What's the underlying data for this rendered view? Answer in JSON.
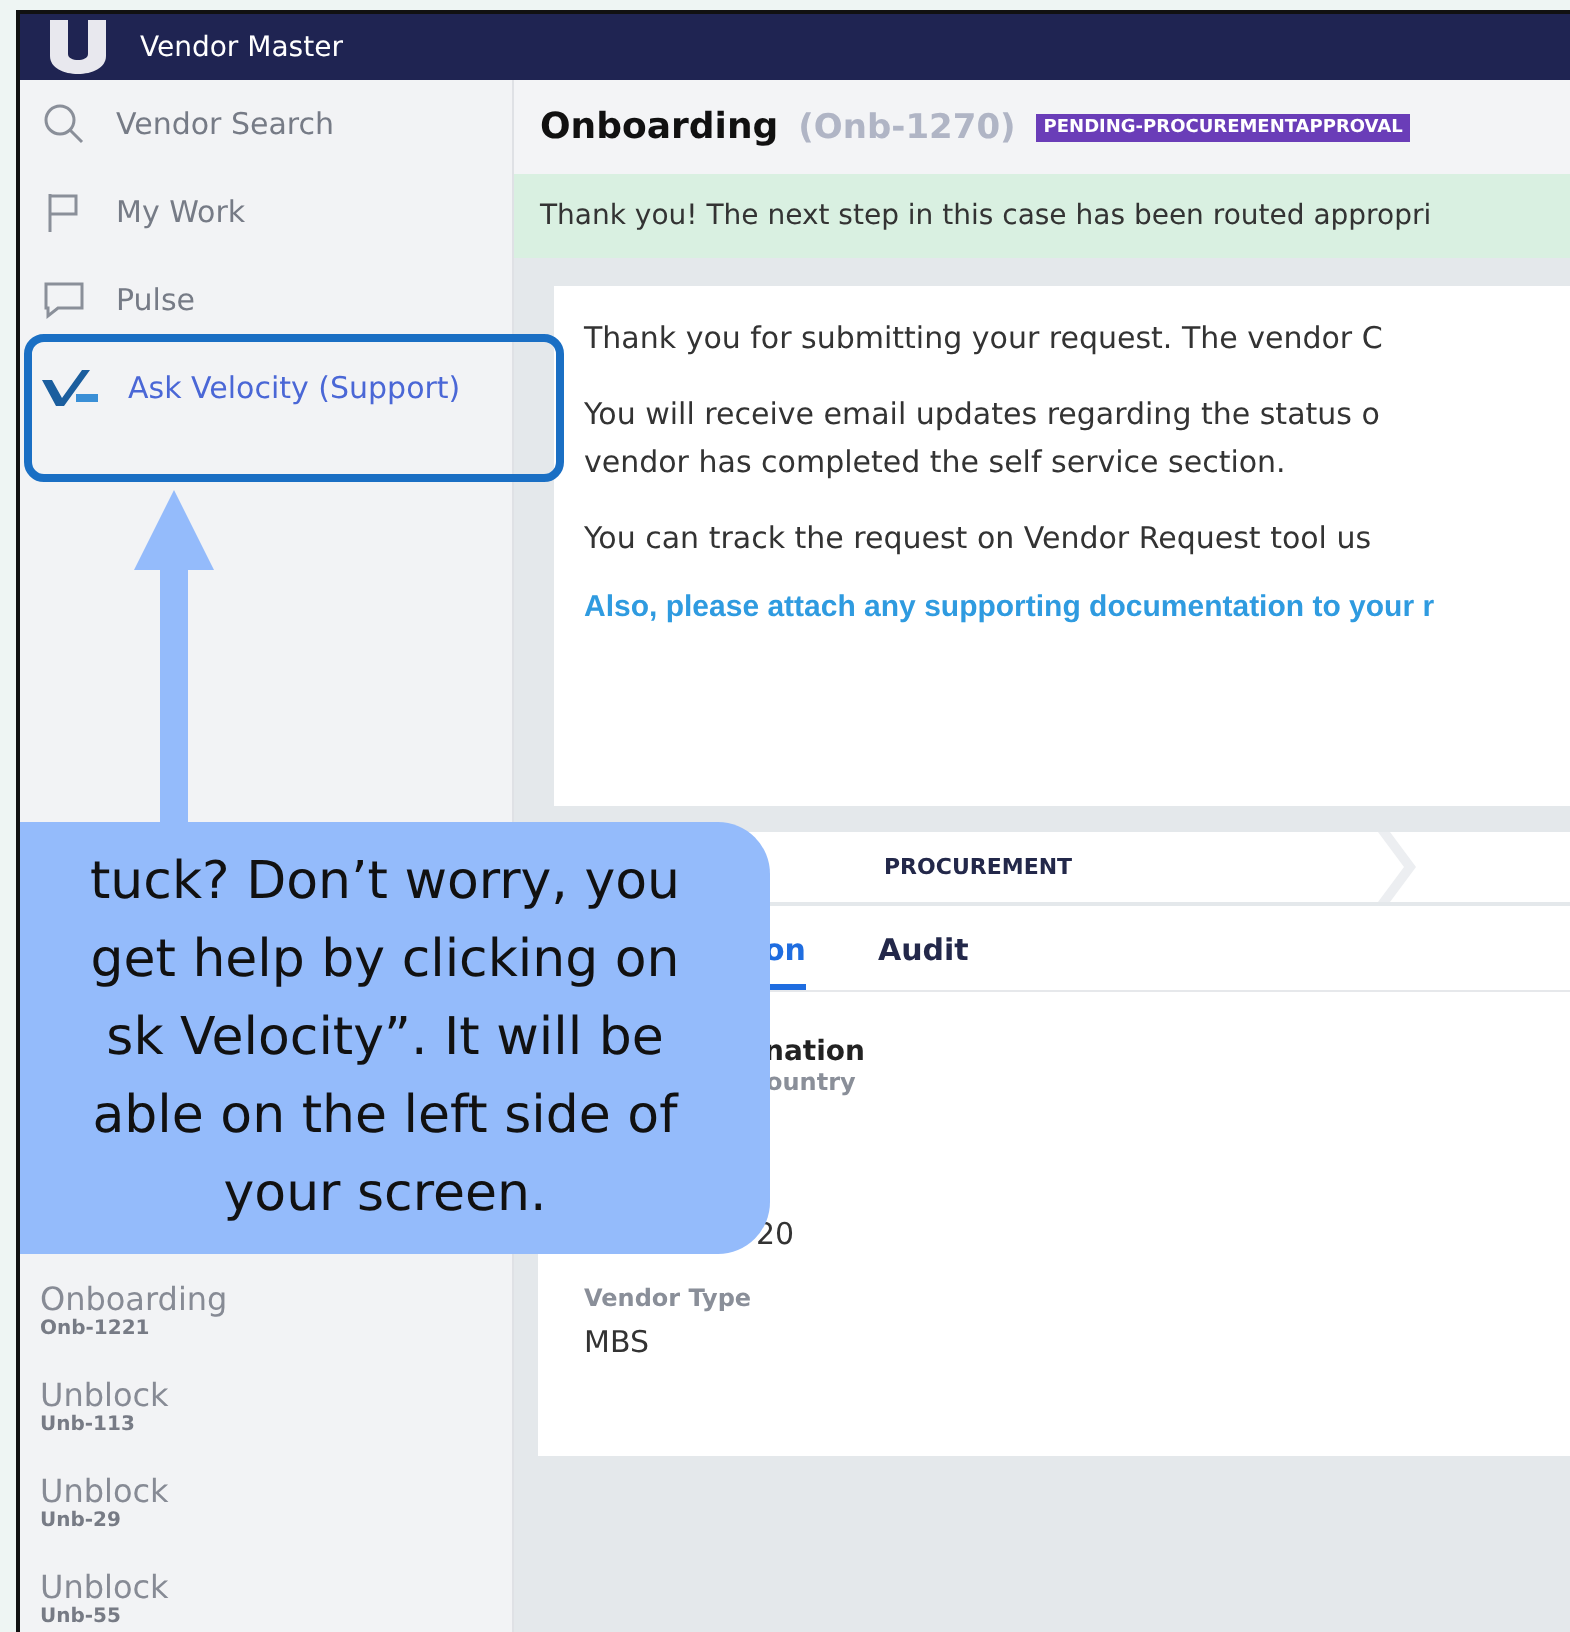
{
  "header": {
    "title": "Vendor Master"
  },
  "nav": [
    {
      "label": "Vendor Search",
      "kind": "search"
    },
    {
      "label": "My Work",
      "kind": "flag"
    },
    {
      "label": "Pulse",
      "kind": "chat"
    },
    {
      "label": "Ask Velocity (Support)",
      "kind": "velocity",
      "highlighted": true
    }
  ],
  "recent": [
    {
      "title": "Onboarding",
      "id": "Onb-1221"
    },
    {
      "title": "Unblock",
      "id": "Unb-113"
    },
    {
      "title": "Unblock",
      "id": "Unb-29"
    },
    {
      "title": "Unblock",
      "id": "Unb-55"
    }
  ],
  "case": {
    "title": "Onboarding",
    "id": "(Onb-1270)",
    "status": "PENDING-PROCUREMENTAPPROVAL"
  },
  "banner": "Thank you! The next step in this case has been routed appropri",
  "message": {
    "paragraphs": [
      "Thank you for submitting your request. The vendor C",
      "You will receive email updates regarding the status o\nvendor has completed the self service section.",
      "You can track the request on Vendor Request tool us"
    ],
    "note": "Also, please attach any supporting documentation to your r"
  },
  "stages": [
    {
      "label": "PROCUREMENT"
    }
  ],
  "tabs": [
    {
      "label": "on",
      "selected": true
    },
    {
      "label": "Audit",
      "selected": false
    }
  ],
  "details": {
    "heading": "nation",
    "fields": [
      {
        "label": "ountry"
      },
      {
        "value": "20"
      },
      {
        "label": "Vendor Type",
        "value": "MBS"
      }
    ]
  },
  "callout": {
    "lines": [
      "tuck? Don’t worry, you",
      "get help by clicking on",
      "sk Velocity”. It will be",
      "able on the left side of",
      "your screen."
    ]
  }
}
